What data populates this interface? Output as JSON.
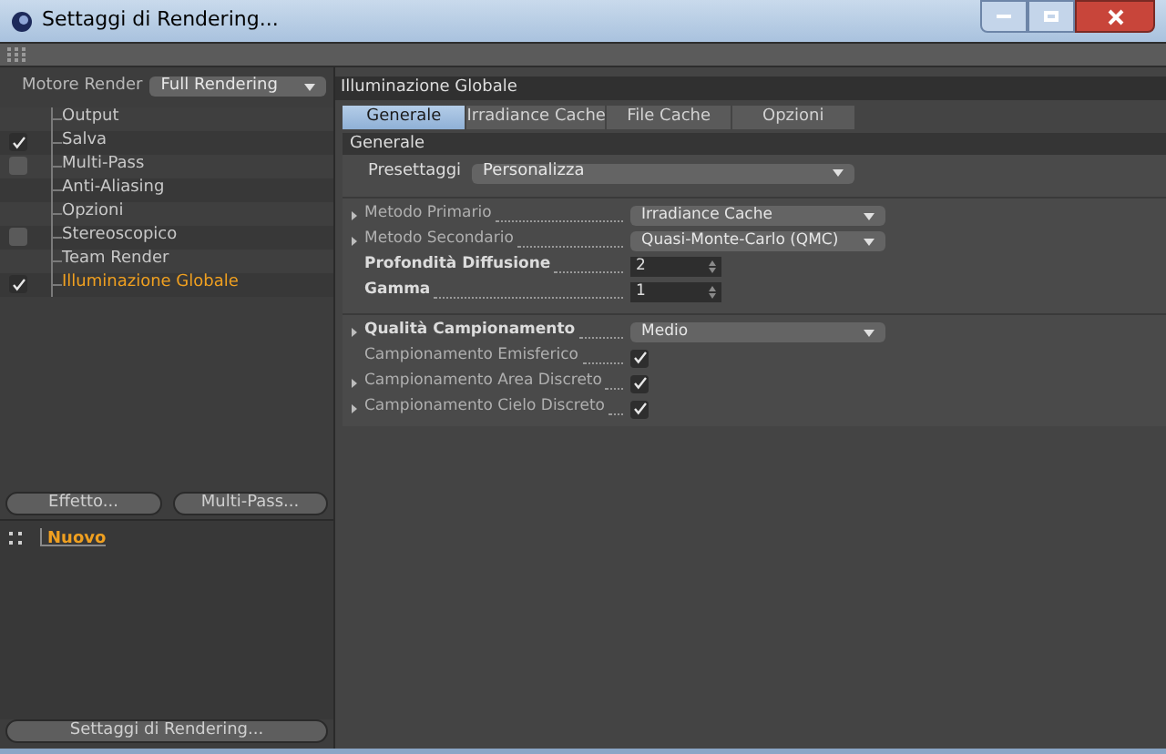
{
  "window": {
    "title": "Settaggi di Rendering..."
  },
  "left": {
    "renderer_label": "Motore Render",
    "renderer_value": "Full Rendering",
    "tree": [
      {
        "label": "Output",
        "kind": "plain",
        "selected": false
      },
      {
        "label": "Salva",
        "kind": "toggle",
        "checked": true,
        "selected": false
      },
      {
        "label": "Multi-Pass",
        "kind": "toggle",
        "checked": false,
        "selected": false
      },
      {
        "label": "Anti-Aliasing",
        "kind": "plain",
        "selected": false
      },
      {
        "label": "Opzioni",
        "kind": "plain",
        "selected": false
      },
      {
        "label": "Stereoscopico",
        "kind": "toggle",
        "checked": false,
        "selected": false
      },
      {
        "label": "Team Render",
        "kind": "plain",
        "selected": false
      },
      {
        "label": "Illuminazione Globale",
        "kind": "toggle",
        "checked": true,
        "selected": true
      }
    ],
    "buttons": [
      "Effetto...",
      "Multi-Pass..."
    ],
    "settings": [
      {
        "label": "Nuovo",
        "selected": true
      }
    ],
    "bottom_button": "Settaggi di Rendering..."
  },
  "right": {
    "title": "Illuminazione Globale",
    "tabs": [
      {
        "label": "Generale",
        "selected": true
      },
      {
        "label": "Irradiance Cache",
        "selected": false
      },
      {
        "label": "File Cache",
        "selected": false
      },
      {
        "label": "Opzioni",
        "selected": false
      }
    ],
    "section": "Generale",
    "preset": {
      "label": "Presettaggi",
      "value": "Personalizza"
    },
    "groups": [
      [
        {
          "kind": "dropdown",
          "label": "Metodo Primario",
          "value": "Irradiance Cache",
          "expandable": true,
          "bold": false
        },
        {
          "kind": "dropdown",
          "label": "Metodo Secondario",
          "value": "Quasi-Monte-Carlo (QMC)",
          "expandable": true,
          "bold": false
        },
        {
          "kind": "number",
          "label": "Profondità Diffusione",
          "value": "2",
          "expandable": false,
          "bold": true
        },
        {
          "kind": "number",
          "label": "Gamma",
          "value": "1",
          "expandable": false,
          "bold": true
        }
      ],
      [
        {
          "kind": "dropdown",
          "label": "Qualità Campionamento",
          "value": "Medio",
          "expandable": true,
          "bold": true
        },
        {
          "kind": "checkbox",
          "label": "Campionamento Emisferico",
          "checked": true,
          "expandable": false,
          "bold": false
        },
        {
          "kind": "checkbox",
          "label": "Campionamento Area Discreto",
          "checked": true,
          "expandable": true,
          "bold": false
        },
        {
          "kind": "checkbox",
          "label": "Campionamento Cielo Discreto",
          "checked": true,
          "expandable": true,
          "bold": false
        }
      ]
    ]
  }
}
